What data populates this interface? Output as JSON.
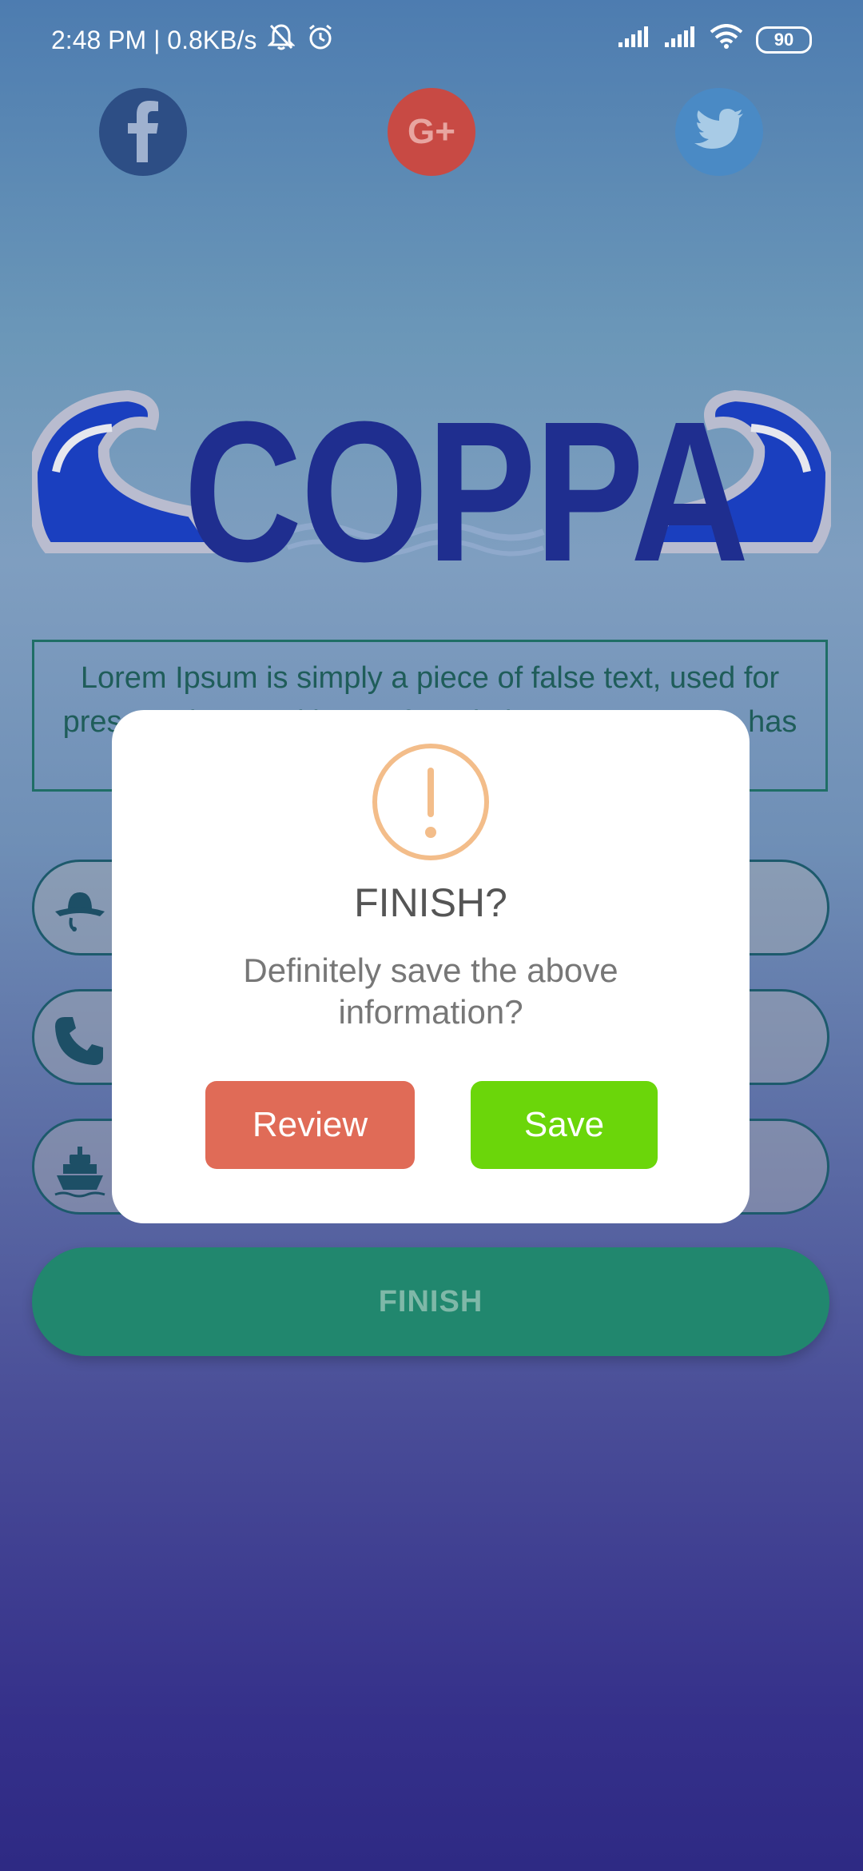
{
  "status_bar": {
    "time_speed": "2:48 PM | 0.8KB/s",
    "battery": "90",
    "icons": [
      "bell-off-icon",
      "alarm-icon",
      "signal-icon",
      "signal-icon",
      "wifi-icon",
      "battery-icon"
    ]
  },
  "social": {
    "items": [
      {
        "name": "facebook",
        "icon": "facebook-icon",
        "color": "#2d4e85"
      },
      {
        "name": "google-plus",
        "icon": "google-plus-icon",
        "color": "#c84a44"
      },
      {
        "name": "twitter",
        "icon": "twitter-icon",
        "color": "#4a8ac5"
      }
    ],
    "google_glyph": "G+"
  },
  "logo": {
    "text": "COPPA"
  },
  "description": {
    "text": "Lorem Ipsum is simply a piece of false text, used for presentations and layout for printing. Lorem Ipsum has been the standard dummy text of the printing"
  },
  "inputs": [
    {
      "icon": "hat-icon"
    },
    {
      "icon": "phone-icon"
    },
    {
      "icon": "ship-icon"
    }
  ],
  "finish_button": {
    "label": "FINISH",
    "color": "#21876e"
  },
  "dialog": {
    "icon": "exclamation-icon",
    "title": "FINISH?",
    "message": "Definitely save the above information?",
    "review_label": "Review",
    "save_label": "Save",
    "review_color": "#e06b57",
    "save_color": "#6bd60a"
  }
}
